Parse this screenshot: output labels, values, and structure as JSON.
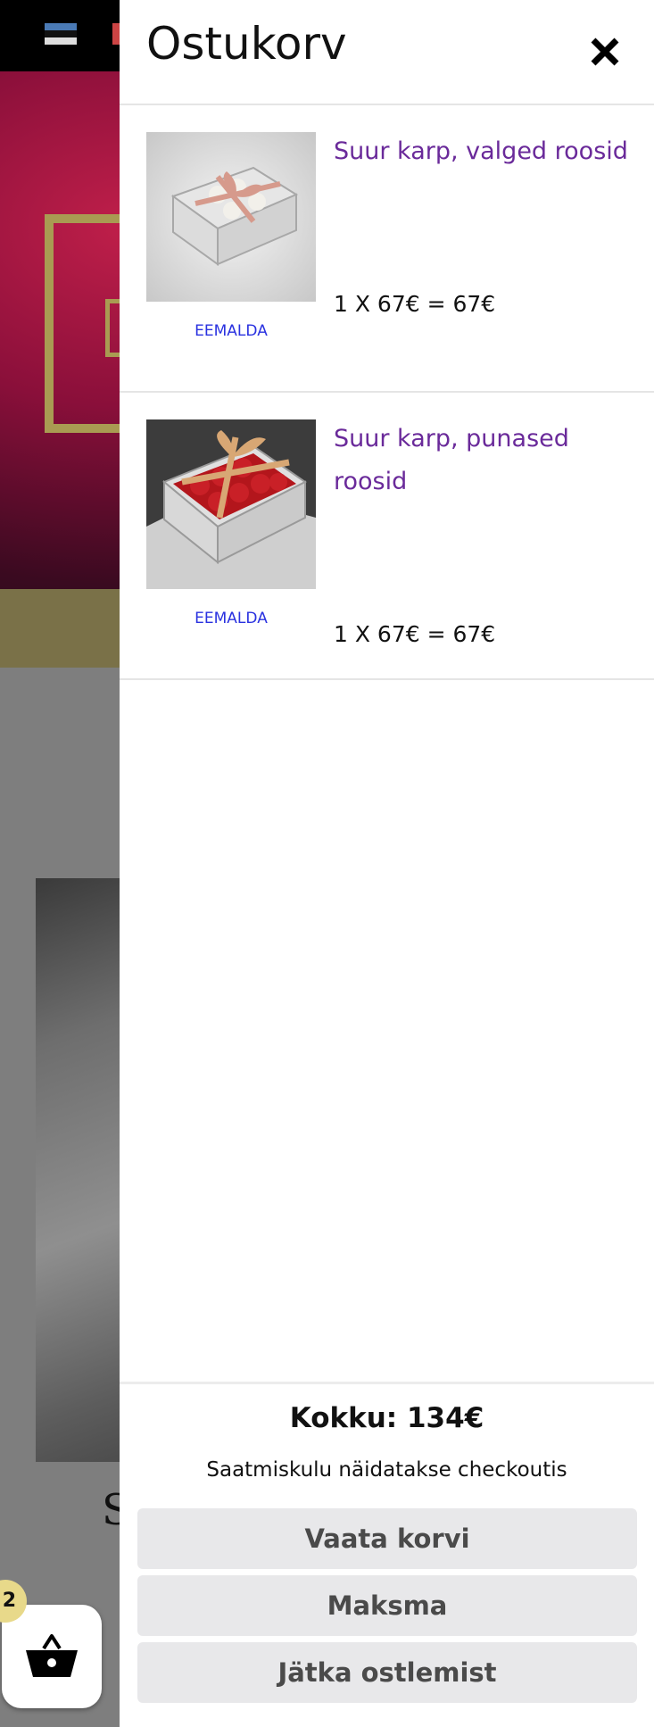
{
  "cart": {
    "title": "Ostukorv",
    "items": [
      {
        "name": "Suur karp, valged roosid",
        "price": "1 X 67€ = 67€",
        "remove_label": "EEMALDA"
      },
      {
        "name": "Suur karp, punased roosid",
        "price": "1 X 67€ = 67€",
        "remove_label": "EEMALDA"
      }
    ],
    "total": "Kokku: 134€",
    "shipping_note": "Saatmiskulu näidatakse checkoutis",
    "buttons": {
      "view_cart": "Vaata korvi",
      "checkout": "Maksma",
      "continue": "Jätka ostlemist"
    }
  },
  "background": {
    "cart_count": "2",
    "partial_heading_letter": "S"
  },
  "icons": {
    "close": "close-icon",
    "basket": "basket-icon",
    "flag_ee": "estonian-flag-icon",
    "flag_en": "english-flag-icon"
  },
  "colors": {
    "link_purple": "#6a2a9a",
    "remove_blue": "#2a32e0",
    "button_grey": "#e8e8ea",
    "badge_yellow": "#e8d98a",
    "gold_accent": "#a99b52"
  }
}
